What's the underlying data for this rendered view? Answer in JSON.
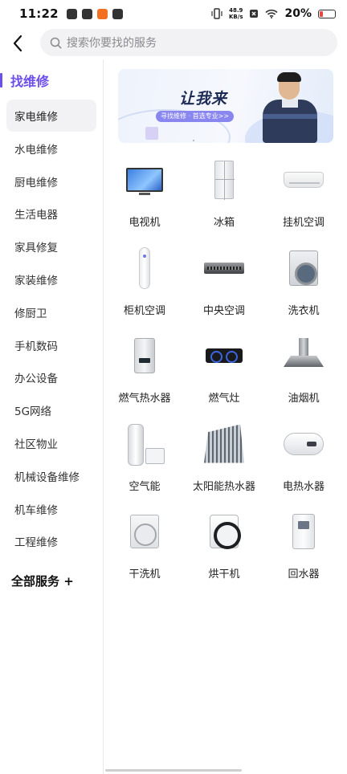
{
  "status_bar": {
    "time": "11:22",
    "net_speed_value": "48.9",
    "net_speed_unit": "KB/s",
    "battery_percent": "20%",
    "battery_level": 0.2,
    "battery_color": "#e8473d"
  },
  "search": {
    "placeholder": "搜索你要找的服务"
  },
  "sidebar": {
    "title": "找维修",
    "accent_color": "#6c4ee8",
    "items": [
      {
        "label": "家电维修",
        "active": true
      },
      {
        "label": "水电维修"
      },
      {
        "label": "厨电维修"
      },
      {
        "label": "生活电器"
      },
      {
        "label": "家具修复"
      },
      {
        "label": "家装维修"
      },
      {
        "label": "修厨卫"
      },
      {
        "label": "手机数码"
      },
      {
        "label": "办公设备"
      },
      {
        "label": "5G网络"
      },
      {
        "label": "社区物业"
      },
      {
        "label": "机械设备维修"
      },
      {
        "label": "机车维修"
      },
      {
        "label": "工程维修"
      }
    ],
    "all_services": "全部服务 +"
  },
  "banner": {
    "title": "让我来",
    "subtitle": "寻找维修 · 首选专业>>"
  },
  "services": [
    {
      "label": "电视机",
      "icon": "tv-icon"
    },
    {
      "label": "冰箱",
      "icon": "fridge-icon"
    },
    {
      "label": "挂机空调",
      "icon": "wall-ac-icon"
    },
    {
      "label": "柜机空调",
      "icon": "standing-ac-icon"
    },
    {
      "label": "中央空调",
      "icon": "central-ac-icon"
    },
    {
      "label": "洗衣机",
      "icon": "washer-icon"
    },
    {
      "label": "燃气热水器",
      "icon": "gas-water-heater-icon"
    },
    {
      "label": "燃气灶",
      "icon": "gas-stove-icon"
    },
    {
      "label": "油烟机",
      "icon": "range-hood-icon"
    },
    {
      "label": "空气能",
      "icon": "air-energy-heater-icon"
    },
    {
      "label": "太阳能热水器",
      "icon": "solar-water-heater-icon"
    },
    {
      "label": "电热水器",
      "icon": "electric-water-heater-icon"
    },
    {
      "label": "干洗机",
      "icon": "dry-cleaning-machine-icon"
    },
    {
      "label": "烘干机",
      "icon": "dryer-icon"
    },
    {
      "label": "回水器",
      "icon": "water-return-device-icon"
    }
  ]
}
